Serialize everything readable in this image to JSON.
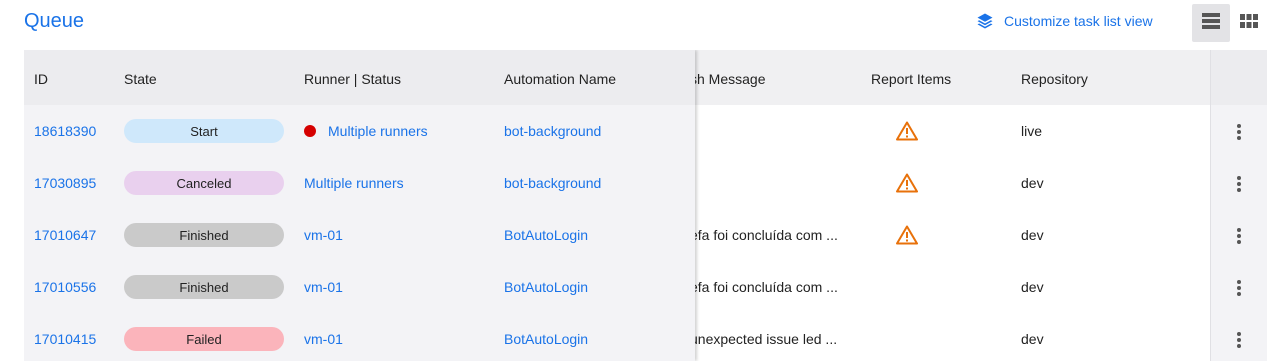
{
  "header": {
    "title": "Queue",
    "customize_label": "Customize task list view"
  },
  "columns": {
    "id": "ID",
    "state": "State",
    "runner_status": "Runner | Status",
    "automation_name": "Automation Name",
    "finish_message": "sh Message",
    "report_items": "Report Items",
    "repository": "Repository"
  },
  "colors": {
    "accent": "#1a73e8",
    "warning": "#e8710a",
    "runner_dot": "#d50000",
    "state_start": "#cfe8fb",
    "state_canceled": "#e9d0ee",
    "state_finished": "#cacaca",
    "state_failed": "#fbb4bb"
  },
  "rows": [
    {
      "id": "18618390",
      "state": "Start",
      "runner": "Multiple runners",
      "runner_dot": true,
      "automation": "bot-background",
      "finish_message": "",
      "report_warning": true,
      "repository": "live"
    },
    {
      "id": "17030895",
      "state": "Canceled",
      "runner": "Multiple runners",
      "runner_dot": false,
      "automation": "bot-background",
      "finish_message": "",
      "report_warning": true,
      "repository": "dev"
    },
    {
      "id": "17010647",
      "state": "Finished",
      "runner": "vm-01",
      "runner_dot": false,
      "automation": "BotAutoLogin",
      "finish_message": "efa foi concluída com ...",
      "report_warning": true,
      "repository": "dev"
    },
    {
      "id": "17010556",
      "state": "Finished",
      "runner": "vm-01",
      "runner_dot": false,
      "automation": "BotAutoLogin",
      "finish_message": "efa foi concluída com ...",
      "report_warning": false,
      "repository": "dev"
    },
    {
      "id": "17010415",
      "state": "Failed",
      "runner": "vm-01",
      "runner_dot": false,
      "automation": "BotAutoLogin",
      "finish_message": "unexpected issue led ...",
      "report_warning": false,
      "repository": "dev"
    }
  ]
}
